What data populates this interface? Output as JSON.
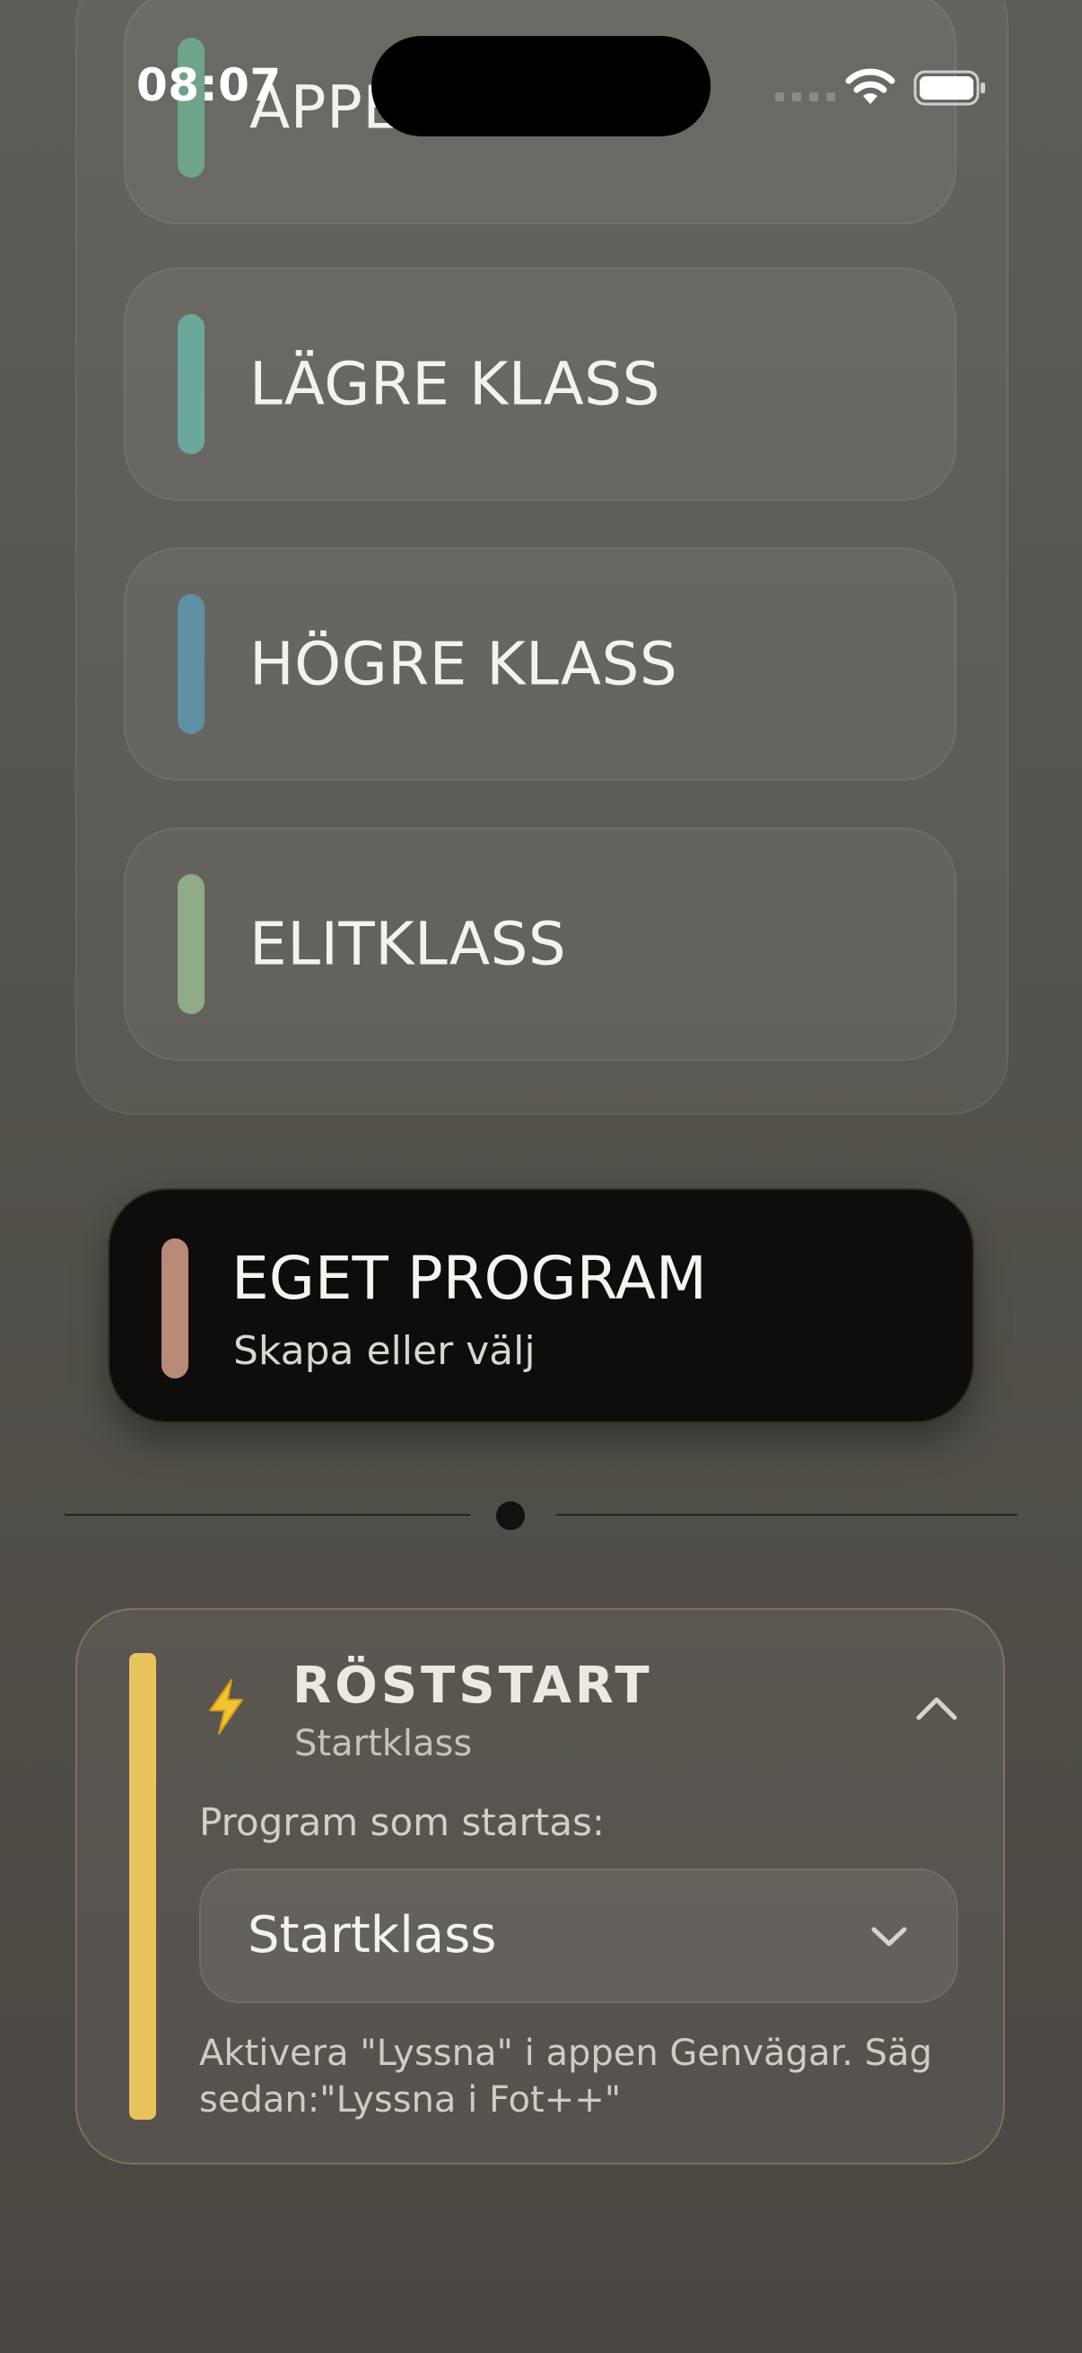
{
  "status_bar": {
    "time": "08:07"
  },
  "classes": [
    {
      "label": "APPEL",
      "color": "#6ea487"
    },
    {
      "label": "LÄGRE KLASS",
      "color": "#6aa89c"
    },
    {
      "label": "HÖGRE KLASS",
      "color": "#5d91a3"
    },
    {
      "label": "ELITKLASS",
      "color": "#8ead86"
    }
  ],
  "custom_program": {
    "title": "EGET PROGRAM",
    "subtitle": "Skapa eller välj",
    "color": "#b88b78"
  },
  "voice_start": {
    "title": "RÖSTSTART",
    "subtitle": "Startklass",
    "program_label": "Program som startas:",
    "selected_program": "Startklass",
    "hint": "Aktivera \"Lyssna\" i appen Genvägar. Säg sedan:\"Lyssna i Fot++\"",
    "accent_color": "#e8c25b",
    "icon": "lightning-icon"
  }
}
